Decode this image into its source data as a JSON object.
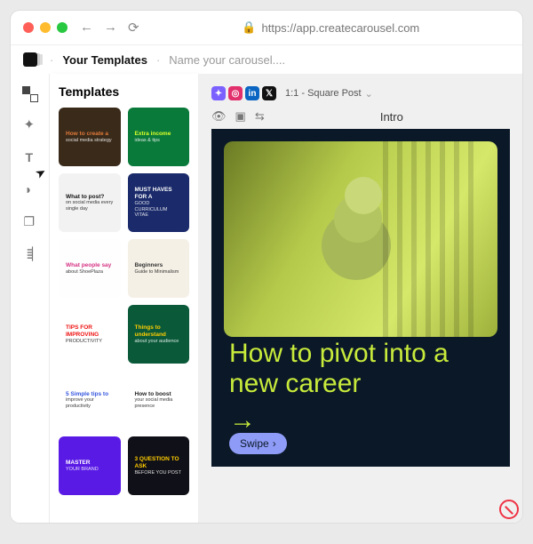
{
  "browser": {
    "url": "https://app.createcarousel.com"
  },
  "crumbs": {
    "templates": "Your Templates",
    "name_placeholder": "Name your carousel...."
  },
  "sidebar_panel": {
    "title": "Templates",
    "items": [
      {
        "title": "How to create a",
        "sub": "social media strategy",
        "bg": "#3a2a1a",
        "accent": "#e07a3a"
      },
      {
        "title": "Extra income",
        "sub": "ideas & tips",
        "bg": "#0a7a3a",
        "accent": "#d8ff2a"
      },
      {
        "title": "What to post?",
        "sub": "on social media every single day",
        "bg": "#f2f2f2",
        "accent": "#111"
      },
      {
        "title": "MUST HAVES FOR A",
        "sub": "GOOD CURRICULUM VITAE",
        "bg": "#1a2a6a",
        "accent": "#fff"
      },
      {
        "title": "What people say",
        "sub": "about ShoePlaza",
        "bg": "#fefefe",
        "accent": "#d63384"
      },
      {
        "title": "Beginners",
        "sub": "Guide to Minimalism",
        "bg": "#f5f0e6",
        "accent": "#333"
      },
      {
        "title": "TIPS FOR IMPROVING",
        "sub": "PRODUCTIVITY",
        "bg": "#ffffff",
        "accent": "#e11"
      },
      {
        "title": "Things to understand",
        "sub": "about your audience",
        "bg": "#0a5a3a",
        "accent": "#ffcc00"
      },
      {
        "title": "5 Simple tips to",
        "sub": "improve your productivity",
        "bg": "#ffffff",
        "accent": "#3355dd"
      },
      {
        "title": "How to boost",
        "sub": "your social media presence",
        "bg": "#ffffff",
        "accent": "#222"
      },
      {
        "title": "MASTER",
        "sub": "YOUR BRAND",
        "bg": "#5a1ae6",
        "accent": "#fff"
      },
      {
        "title": "3 QUESTION TO ASK",
        "sub": "BEFORE YOU POST",
        "bg": "#101018",
        "accent": "#ffcc00"
      }
    ]
  },
  "stage": {
    "ratio_label": "1:1 - Square Post",
    "slide_label": "Intro",
    "headline": "How to pivot into a new career",
    "swipe": "Swipe"
  }
}
